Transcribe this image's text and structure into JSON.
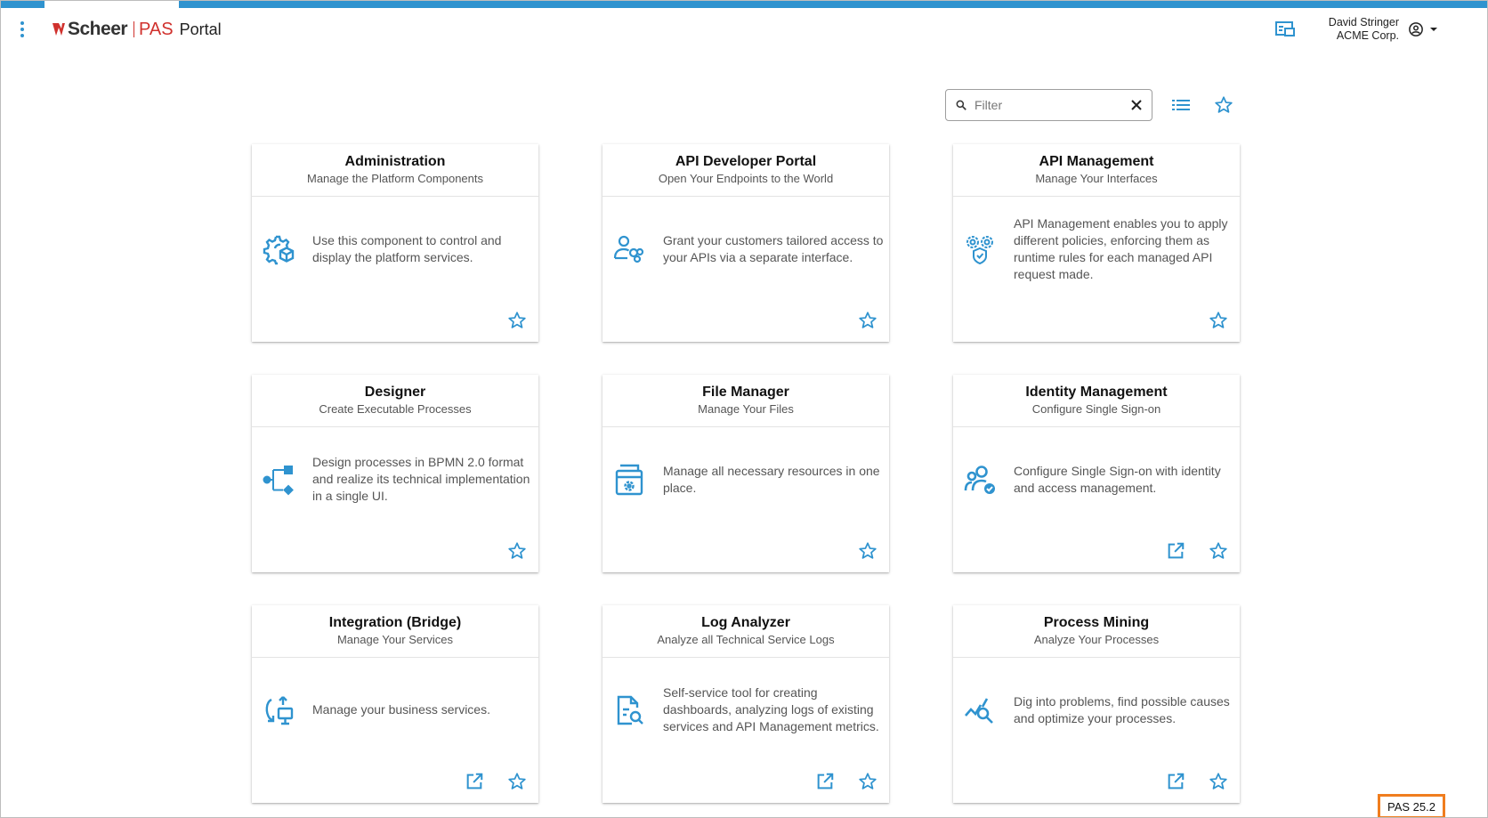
{
  "header": {
    "brand_name": "Scheer",
    "brand_product": "PAS",
    "app_title": "Portal",
    "user_name": "David Stringer",
    "user_org": "ACME Corp.",
    "accent_color": "#2f93cf",
    "brand_color": "#d0312d"
  },
  "toolbar": {
    "filter_placeholder": "Filter",
    "filter_value": ""
  },
  "cards": [
    {
      "title": "Administration",
      "subtitle": "Manage the Platform Components",
      "description": "Use this component to control and display the platform services.",
      "icon": "gear-cube-icon",
      "external_link": false
    },
    {
      "title": "API Developer Portal",
      "subtitle": "Open Your Endpoints to the World",
      "description": "Grant your customers tailored access to your APIs via a separate interface.",
      "icon": "user-gears-icon",
      "external_link": false
    },
    {
      "title": "API Management",
      "subtitle": "Manage Your Interfaces",
      "description": "API Management enables you to apply different policies, enforcing them as runtime rules for each managed API request made.",
      "icon": "gears-shield-icon",
      "external_link": false
    },
    {
      "title": "Designer",
      "subtitle": "Create Executable Processes",
      "description": "Design processes in BPMN 2.0 format and realize its technical implementation in a single UI.",
      "icon": "process-flow-icon",
      "external_link": false
    },
    {
      "title": "File Manager",
      "subtitle": "Manage Your Files",
      "description": "Manage all necessary resources in one place.",
      "icon": "file-gear-icon",
      "external_link": false
    },
    {
      "title": "Identity Management",
      "subtitle": "Configure Single Sign-on",
      "description": "Configure Single Sign-on with identity and access management.",
      "icon": "users-shield-icon",
      "external_link": true
    },
    {
      "title": "Integration (Bridge)",
      "subtitle": "Manage Your Services",
      "description": "Manage your business services.",
      "icon": "integration-bridge-icon",
      "external_link": true
    },
    {
      "title": "Log Analyzer",
      "subtitle": "Analyze all Technical Service Logs",
      "description": "Self-service tool for creating dashboards, analyzing logs of existing services and API Management metrics.",
      "icon": "document-search-icon",
      "external_link": true
    },
    {
      "title": "Process Mining",
      "subtitle": "Analyze Your Processes",
      "description": "Dig into problems, find possible causes and optimize your processes.",
      "icon": "chart-search-icon",
      "external_link": true
    }
  ],
  "footer": {
    "version": "PAS 25.2"
  }
}
